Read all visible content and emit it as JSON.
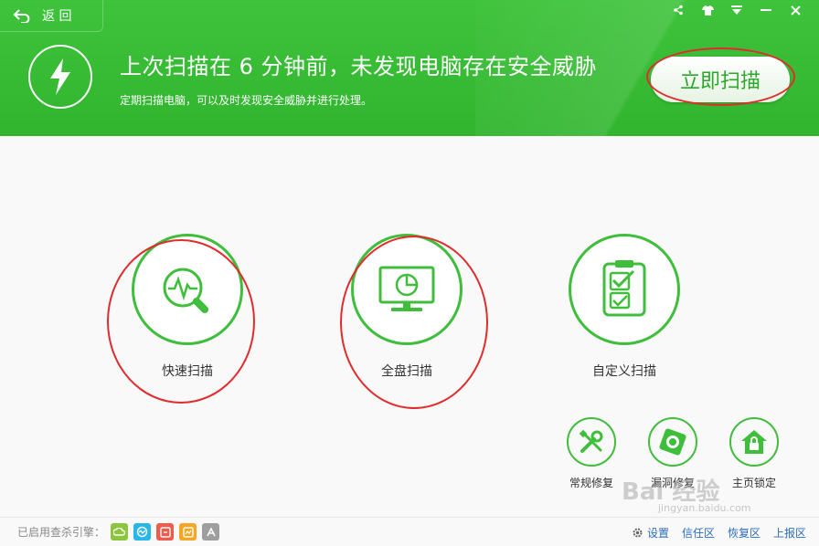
{
  "header": {
    "back_label": "返 回",
    "title": "上次扫描在 6 分钟前，未发现电脑存在安全威胁",
    "subtitle": "定期扫描电脑，可以及时发现安全威胁并进行处理。",
    "scan_now_label": "立即扫描",
    "window_controls": [
      "share-icon",
      "skin-icon",
      "menu-icon",
      "minimize-icon",
      "close-icon"
    ]
  },
  "scan_modes": [
    {
      "label": "快速扫描",
      "icon": "quick-scan-icon"
    },
    {
      "label": "全盘扫描",
      "icon": "full-scan-icon"
    },
    {
      "label": "自定义扫描",
      "icon": "custom-scan-icon"
    }
  ],
  "tools": [
    {
      "label": "常规修复",
      "icon": "wrench-icon"
    },
    {
      "label": "漏洞修复",
      "icon": "vulnerability-icon"
    },
    {
      "label": "主页锁定",
      "icon": "home-lock-icon"
    }
  ],
  "footer": {
    "engines_label": "已启用查杀引擎：",
    "engine_colors": [
      "#8cc63f",
      "#29b6e8",
      "#ef5b4c",
      "#f5a623",
      "#9e9e9e"
    ],
    "settings_label": "设置",
    "links": [
      "信任区",
      "恢复区",
      "上报区"
    ]
  },
  "watermark": {
    "text": "Bai 经验",
    "sub": "jingyan.baidu.com"
  },
  "colors": {
    "accent": "#3fbe3c",
    "header": "#39bb36",
    "annotation": "#e02c2c"
  }
}
